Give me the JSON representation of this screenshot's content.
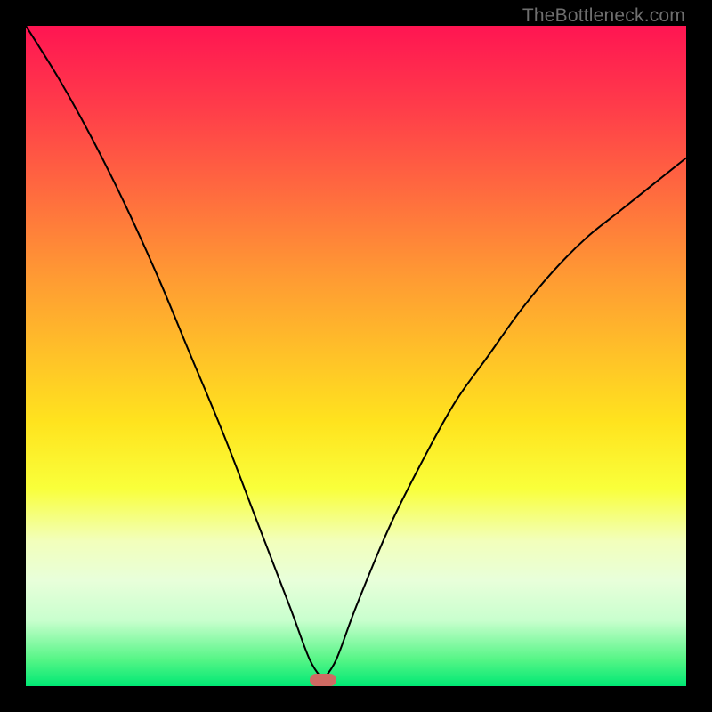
{
  "watermark": "TheBottleneck.com",
  "chart_data": {
    "type": "line",
    "title": "",
    "xlabel": "",
    "ylabel": "",
    "xlim": [
      0,
      100
    ],
    "ylim": [
      0,
      100
    ],
    "background_gradient_values": [
      100,
      0
    ],
    "minimum_marker_x": 45,
    "series": [
      {
        "name": "bottleneck-curve",
        "x": [
          0,
          5,
          10,
          15,
          20,
          25,
          30,
          35,
          40,
          43,
          45,
          47,
          50,
          55,
          60,
          65,
          70,
          75,
          80,
          85,
          90,
          95,
          100
        ],
        "values": [
          100,
          92,
          83,
          73,
          62,
          50,
          38,
          25,
          12,
          4,
          1,
          4,
          12,
          24,
          34,
          43,
          50,
          57,
          63,
          68,
          72,
          76,
          80
        ]
      }
    ]
  },
  "colors": {
    "curve": "#000000",
    "marker": "#cf6a63",
    "frame": "#000000"
  }
}
